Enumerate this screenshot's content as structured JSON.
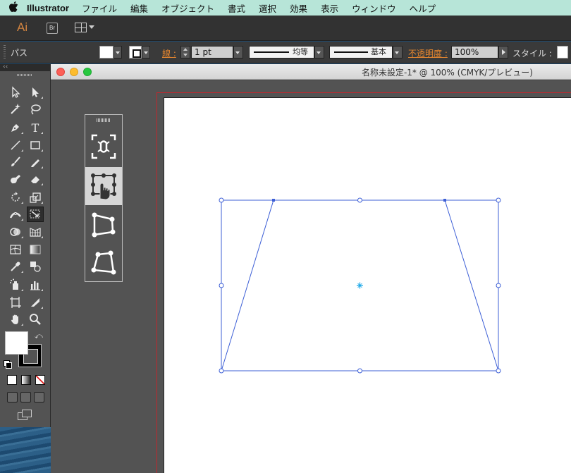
{
  "menubar": {
    "app_name": "Illustrator",
    "items": [
      "ファイル",
      "編集",
      "オブジェクト",
      "書式",
      "選択",
      "効果",
      "表示",
      "ウィンドウ",
      "ヘルプ"
    ]
  },
  "appbar": {
    "logo": "Ai",
    "bridge_label": "Br"
  },
  "control_bar": {
    "selection_type": "パス",
    "stroke_label": "線 :",
    "stroke_weight": "1 pt",
    "variable_width_label": "均等",
    "brush_label": "基本",
    "opacity_label": "不透明度 :",
    "opacity_value": "100%",
    "style_label": "スタイル :"
  },
  "document": {
    "title": "名称未設定-1* @ 100% (CMYK/プレビュー)"
  },
  "tools": [
    "selection-tool",
    "direct-selection-tool",
    "magic-wand-tool",
    "lasso-tool",
    "pen-tool",
    "type-tool",
    "line-segment-tool",
    "rectangle-tool",
    "paintbrush-tool",
    "pencil-tool",
    "blob-brush-tool",
    "eraser-tool",
    "rotate-tool",
    "scale-tool",
    "width-tool",
    "free-transform-tool",
    "shape-builder-tool",
    "perspective-grid-tool",
    "mesh-tool",
    "gradient-tool",
    "eyedropper-tool",
    "blend-tool",
    "symbol-sprayer-tool",
    "column-graph-tool",
    "artboard-tool",
    "slice-tool",
    "hand-tool",
    "zoom-tool"
  ],
  "active_tool": "free-transform-tool",
  "touch_widget": {
    "items": [
      "constrain",
      "free-transform",
      "perspective-distort",
      "free-distort"
    ],
    "active": "free-transform"
  },
  "colors": {
    "menubar_bg": "#b7e5d8",
    "accent_orange": "#e5862f",
    "selection_blue": "#3d5fd6",
    "artboard_border": "#c0272d",
    "center_point": "#19a7e8"
  }
}
